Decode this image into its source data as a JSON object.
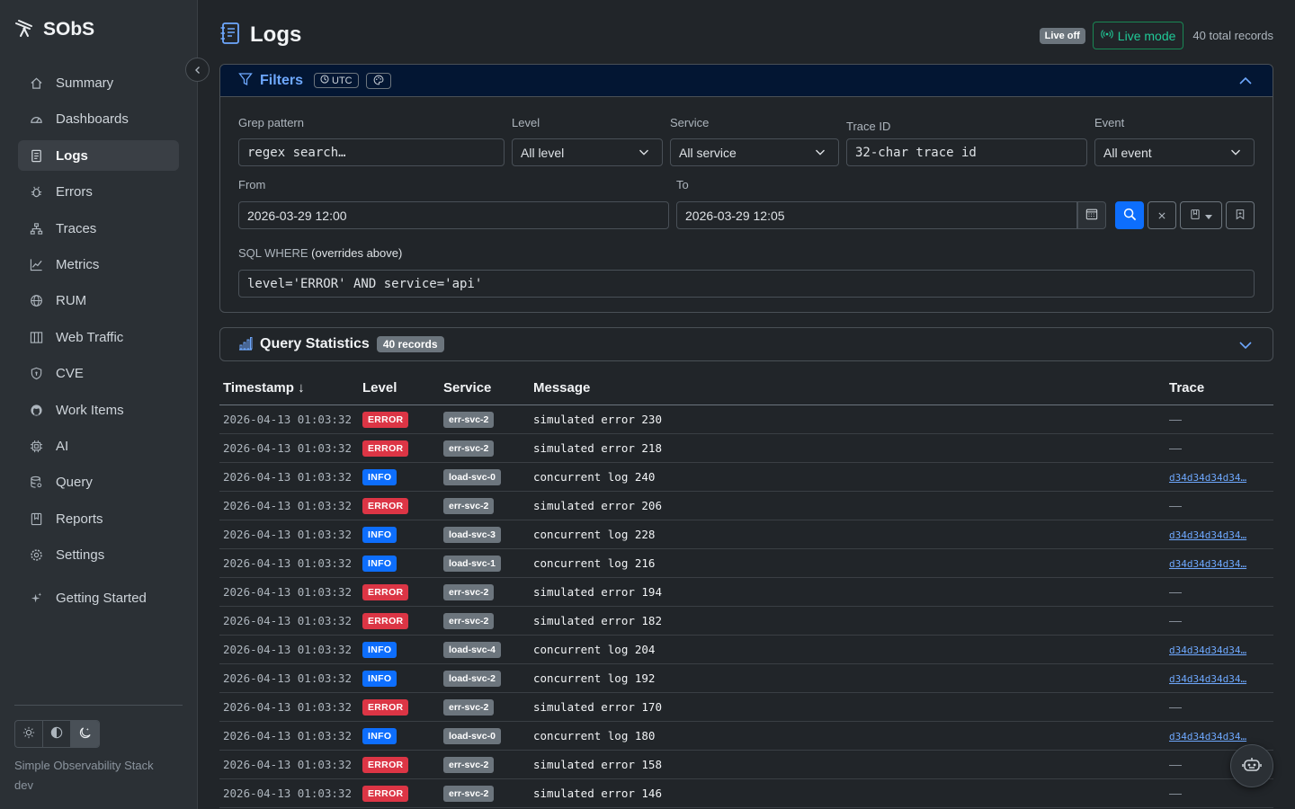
{
  "app": {
    "brand": "SObS",
    "name": "Simple Observability Stack",
    "env": "dev"
  },
  "sidebar": {
    "items": [
      {
        "label": "Summary",
        "icon": "house-icon"
      },
      {
        "label": "Dashboards",
        "icon": "speedometer-icon"
      },
      {
        "label": "Logs",
        "icon": "journal-icon",
        "active": true
      },
      {
        "label": "Errors",
        "icon": "bug-icon"
      },
      {
        "label": "Traces",
        "icon": "diagram-icon"
      },
      {
        "label": "Metrics",
        "icon": "graph-up-icon"
      },
      {
        "label": "RUM",
        "icon": "globe-icon"
      },
      {
        "label": "Web Traffic",
        "icon": "columns-icon"
      },
      {
        "label": "CVE",
        "icon": "shield-icon"
      },
      {
        "label": "Work Items",
        "icon": "github-icon"
      },
      {
        "label": "AI",
        "icon": "cpu-icon"
      },
      {
        "label": "Query",
        "icon": "database-icon"
      },
      {
        "label": "Reports",
        "icon": "bookmark-icon"
      },
      {
        "label": "Settings",
        "icon": "gear-icon"
      },
      {
        "label": "Getting Started",
        "icon": "stars-icon"
      }
    ]
  },
  "header": {
    "title": "Logs",
    "live_off": "Live off",
    "live_mode": "Live mode",
    "total_records": "40 total records"
  },
  "filters": {
    "title": "Filters",
    "utc": "UTC",
    "grep": {
      "label": "Grep pattern",
      "placeholder": "regex search…"
    },
    "level": {
      "label": "Level",
      "value": "All level"
    },
    "service": {
      "label": "Service",
      "value": "All service"
    },
    "trace": {
      "label": "Trace ID",
      "placeholder": "32-char trace id"
    },
    "event": {
      "label": "Event",
      "value": "All event"
    },
    "from": {
      "label": "From",
      "value": "2026-03-29 12:00"
    },
    "to": {
      "label": "To",
      "value": "2026-03-29 12:05"
    },
    "sql": {
      "label": "SQL WHERE",
      "note": "(overrides above)",
      "placeholder": "level='ERROR' AND service='api'"
    }
  },
  "stats": {
    "title": "Query Statistics",
    "badge": "40 records"
  },
  "table": {
    "columns": {
      "timestamp": "Timestamp ↓",
      "level": "Level",
      "service": "Service",
      "message": "Message",
      "trace": "Trace"
    },
    "rows": [
      {
        "ts": "2026-04-13 01:03:32",
        "level": "ERROR",
        "service": "err-svc-2",
        "message": "simulated error 230",
        "trace": "—"
      },
      {
        "ts": "2026-04-13 01:03:32",
        "level": "ERROR",
        "service": "err-svc-2",
        "message": "simulated error 218",
        "trace": "—"
      },
      {
        "ts": "2026-04-13 01:03:32",
        "level": "INFO",
        "service": "load-svc-0",
        "message": "concurrent log 240",
        "trace": "d34d34d34d34…"
      },
      {
        "ts": "2026-04-13 01:03:32",
        "level": "ERROR",
        "service": "err-svc-2",
        "message": "simulated error 206",
        "trace": "—"
      },
      {
        "ts": "2026-04-13 01:03:32",
        "level": "INFO",
        "service": "load-svc-3",
        "message": "concurrent log 228",
        "trace": "d34d34d34d34…"
      },
      {
        "ts": "2026-04-13 01:03:32",
        "level": "INFO",
        "service": "load-svc-1",
        "message": "concurrent log 216",
        "trace": "d34d34d34d34…"
      },
      {
        "ts": "2026-04-13 01:03:32",
        "level": "ERROR",
        "service": "err-svc-2",
        "message": "simulated error 194",
        "trace": "—"
      },
      {
        "ts": "2026-04-13 01:03:32",
        "level": "ERROR",
        "service": "err-svc-2",
        "message": "simulated error 182",
        "trace": "—"
      },
      {
        "ts": "2026-04-13 01:03:32",
        "level": "INFO",
        "service": "load-svc-4",
        "message": "concurrent log 204",
        "trace": "d34d34d34d34…"
      },
      {
        "ts": "2026-04-13 01:03:32",
        "level": "INFO",
        "service": "load-svc-2",
        "message": "concurrent log 192",
        "trace": "d34d34d34d34…"
      },
      {
        "ts": "2026-04-13 01:03:32",
        "level": "ERROR",
        "service": "err-svc-2",
        "message": "simulated error 170",
        "trace": "—"
      },
      {
        "ts": "2026-04-13 01:03:32",
        "level": "INFO",
        "service": "load-svc-0",
        "message": "concurrent log 180",
        "trace": "d34d34d34d34…"
      },
      {
        "ts": "2026-04-13 01:03:32",
        "level": "ERROR",
        "service": "err-svc-2",
        "message": "simulated error 158",
        "trace": "—"
      },
      {
        "ts": "2026-04-13 01:03:32",
        "level": "ERROR",
        "service": "err-svc-2",
        "message": "simulated error 146",
        "trace": "—"
      }
    ]
  }
}
